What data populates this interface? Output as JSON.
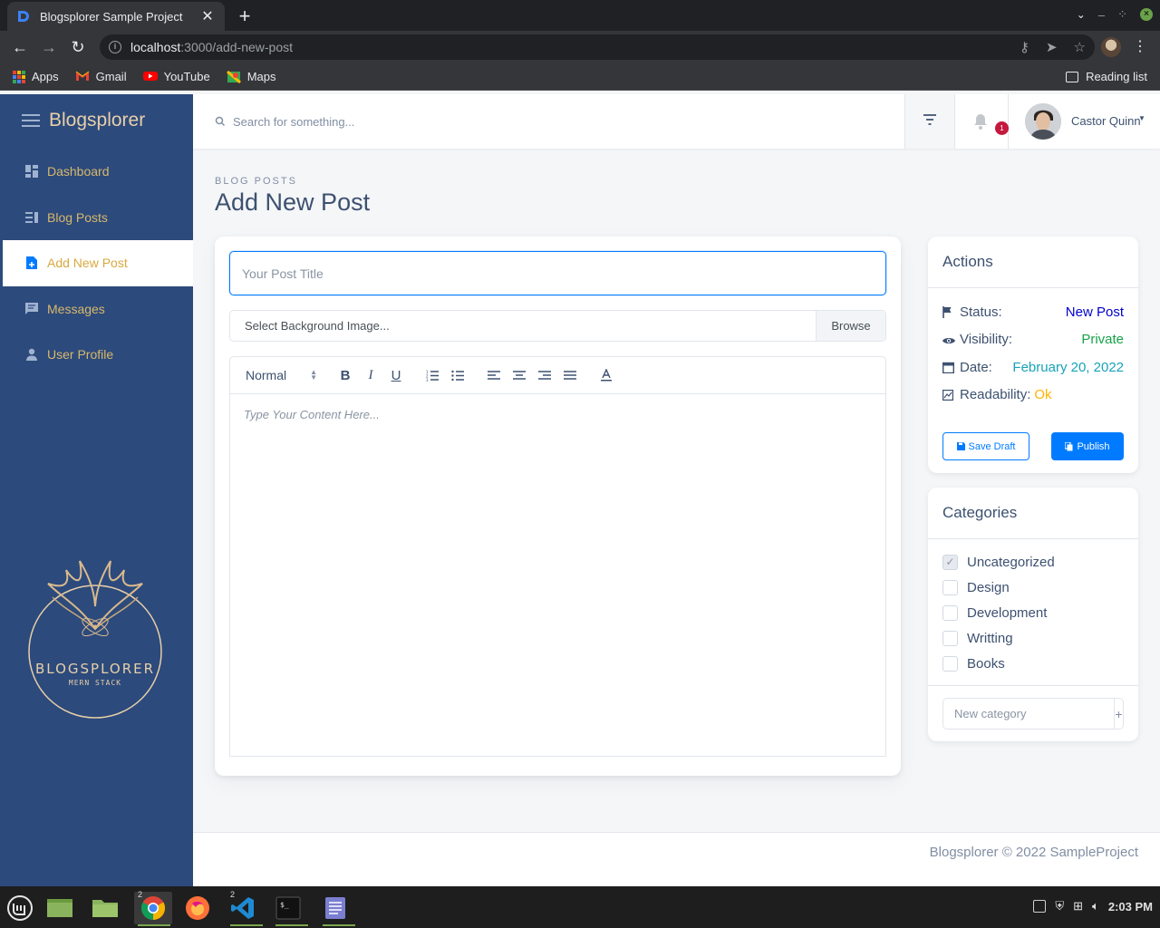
{
  "browser": {
    "tab_title": "Blogsplorer Sample Project",
    "url_host": "localhost",
    "url_path": ":3000/add-new-post",
    "bookmarks": [
      {
        "label": "Apps",
        "icon": "apps-grid-icon"
      },
      {
        "label": "Gmail",
        "icon": "gmail-icon"
      },
      {
        "label": "YouTube",
        "icon": "youtube-icon"
      },
      {
        "label": "Maps",
        "icon": "maps-icon"
      }
    ],
    "reading_list": "Reading list"
  },
  "sidebar": {
    "brand": "Blogsplorer",
    "items": [
      {
        "label": "Dashboard",
        "icon": "dashboard-icon",
        "active": false
      },
      {
        "label": "Blog Posts",
        "icon": "posts-icon",
        "active": false
      },
      {
        "label": "Add New Post",
        "icon": "note-add-icon",
        "active": true
      },
      {
        "label": "Messages",
        "icon": "message-icon",
        "active": false
      },
      {
        "label": "User Profile",
        "icon": "person-icon",
        "active": false
      }
    ],
    "logo": {
      "title": "BLOGSPLORER",
      "subtitle": "MERN STACK"
    }
  },
  "topbar": {
    "search_placeholder": "Search for something...",
    "notifications": "1",
    "user_name": "Castor Quinn"
  },
  "page": {
    "subtitle": "BLOG POSTS",
    "title": "Add New Post"
  },
  "editor": {
    "title_placeholder": "Your Post Title",
    "file_label": "Select Background Image...",
    "browse": "Browse",
    "format_select": "Normal",
    "content_placeholder": "Type Your Content Here..."
  },
  "actions": {
    "title": "Actions",
    "rows": [
      {
        "label": "Status:",
        "value": "New Post",
        "value_color": "#0000cc",
        "icon": "flag-icon"
      },
      {
        "label": "Visibility:",
        "value": "Private",
        "value_color": "#16a34a",
        "icon": "eye-icon"
      },
      {
        "label": "Date:",
        "value": "February 20, 2022",
        "value_color": "#17a2b8",
        "icon": "calendar-icon"
      },
      {
        "label": "Readability:",
        "value": "Ok",
        "value_color": "#ffb400",
        "icon": "score-icon"
      }
    ],
    "save_draft": "Save Draft",
    "publish": "Publish"
  },
  "categories": {
    "title": "Categories",
    "items": [
      {
        "label": "Uncategorized",
        "checked": true
      },
      {
        "label": "Design",
        "checked": false
      },
      {
        "label": "Development",
        "checked": false
      },
      {
        "label": "Writting",
        "checked": false
      },
      {
        "label": "Books",
        "checked": false
      }
    ],
    "new_placeholder": "New category",
    "add": "+"
  },
  "footer": {
    "text": "Blogsplorer © 2022 SampleProject"
  },
  "taskbar": {
    "time": "2:03 PM",
    "chrome_count": "2",
    "vscode_count": "2"
  },
  "colors": {
    "sidebar_bg": "#2c4a7c",
    "accent_gold": "#d8b86b",
    "primary": "#007bff"
  }
}
